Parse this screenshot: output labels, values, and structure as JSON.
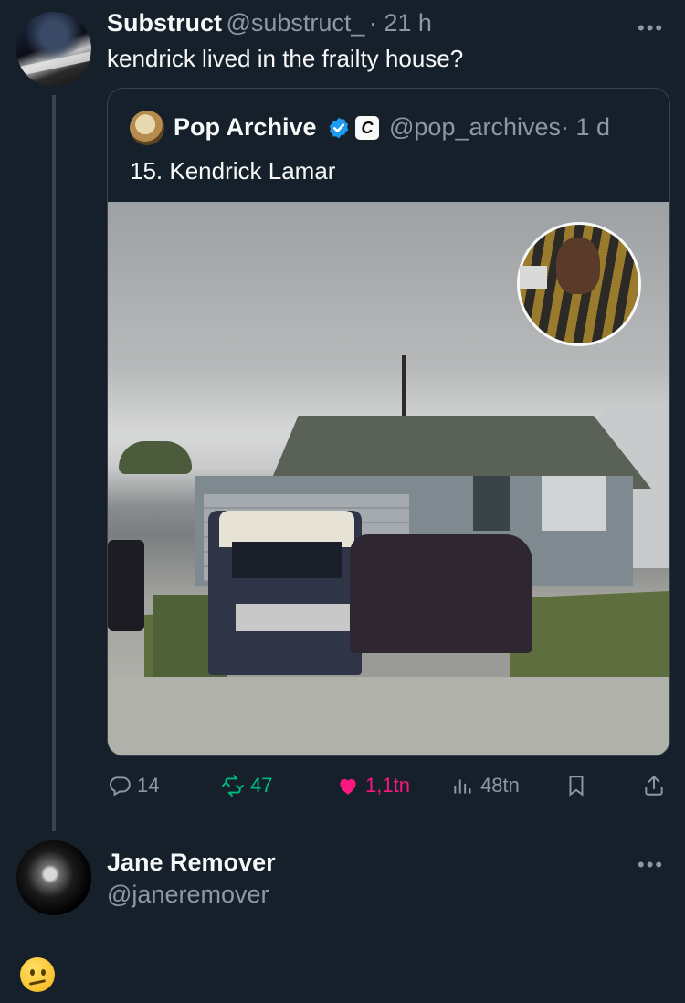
{
  "tweet": {
    "author_name": "Substruct",
    "author_handle": "@substruct_",
    "time": "· 21 h",
    "text": "kendrick lived in the frailty house?",
    "more": "•••"
  },
  "quote": {
    "author_name": "Pop Archive",
    "author_handle": "@pop_archives",
    "time": "· 1 d",
    "affiliate_badge": "C",
    "text": "15. Kendrick Lamar"
  },
  "actions": {
    "replies": "14",
    "reposts": "47",
    "likes": "1,1tn",
    "views": "48tn"
  },
  "reply": {
    "author_name": "Jane Remover",
    "author_handle": "@janeremover",
    "more": "•••"
  },
  "colors": {
    "background": "#15202b",
    "text": "#f7f9f9",
    "muted": "#8b98a5",
    "repost_green": "#00ba7c",
    "like_pink": "#f91880",
    "verified_blue": "#1d9bf0"
  }
}
